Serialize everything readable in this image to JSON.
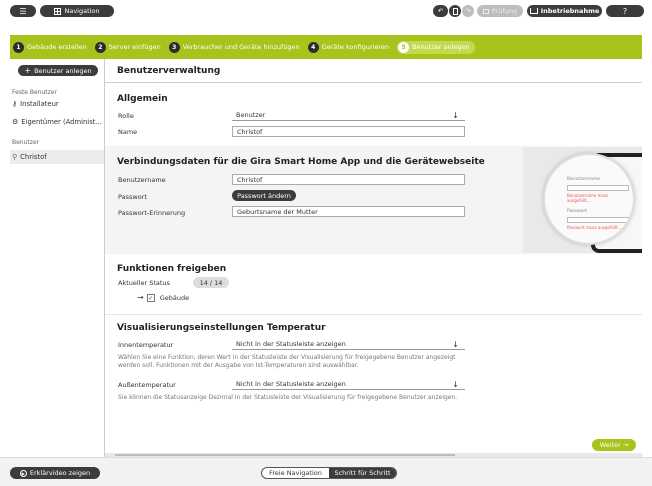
{
  "topbar": {
    "nav_label": "Navigation",
    "pruefung_label": "Prüfung",
    "inbetrieb_label": "Inbetriebnahme",
    "help_label": "?"
  },
  "steps": [
    {
      "num": "1",
      "label": "Gebäude erstellen"
    },
    {
      "num": "2",
      "label": "Server einfügen"
    },
    {
      "num": "3",
      "label": "Verbraucher und Geräte hinzufügen"
    },
    {
      "num": "4",
      "label": "Geräte konfigurieren"
    },
    {
      "num": "5",
      "label": "Benutzer anlegen"
    }
  ],
  "sidebar": {
    "add_user_label": "Benutzer anlegen",
    "fixed_heading": "Feste Benutzer",
    "fixed_items": [
      "Installateur",
      "Eigentümer (Administ..."
    ],
    "user_heading": "Benutzer",
    "user_items": [
      "Christof"
    ]
  },
  "main": {
    "header": "Benutzerverwaltung",
    "general": {
      "title": "Allgemein",
      "role_label": "Rolle",
      "role_value": "Benutzer",
      "name_label": "Name",
      "name_value": "Christof"
    },
    "connection": {
      "title": "Verbindungsdaten für die Gira Smart Home App und die Gerätewebseite",
      "username_label": "Benutzername",
      "username_value": "Christof",
      "password_label": "Passwort",
      "password_button": "Passwort ändern",
      "reminder_label": "Passwort-Erinnerung",
      "reminder_value": "Geburtsname der Mutter",
      "phone_lines": [
        "Benutzername",
        "Benutzername muss ausgefüllt...",
        "Passwort",
        "Passwort muss ausgefüllt..."
      ]
    },
    "functions": {
      "title": "Funktionen freigeben",
      "status_label": "Aktueller Status",
      "status_value": "14 / 14",
      "item_label": "Gebäude"
    },
    "visual": {
      "title": "Visualisierungseinstellungen Temperatur",
      "inner_label": "Innentemperatur",
      "inner_value": "Nicht in der Statusleiste anzeigen",
      "inner_desc": "Wählen Sie eine Funktion, deren Wert in der Statusleiste der Visualisierung für freigegebene Benutzer angezeigt werden soll. Funktionen mit der Ausgabe von Ist-Temperaturen sind auswählbar.",
      "outer_label": "Außentemperatur",
      "outer_value": "Nicht in der Statusleiste anzeigen",
      "outer_desc": "Sie können die Statusanzeige Dezimal in der Statusleiste der Visualisierung für freigegebene Benutzer anzeigen."
    },
    "next_label": "Weiter"
  },
  "footer": {
    "video_label": "Erklärvideo zeigen",
    "free_nav_label": "Freie Navigation",
    "step_label": "Schritt für Schritt"
  }
}
